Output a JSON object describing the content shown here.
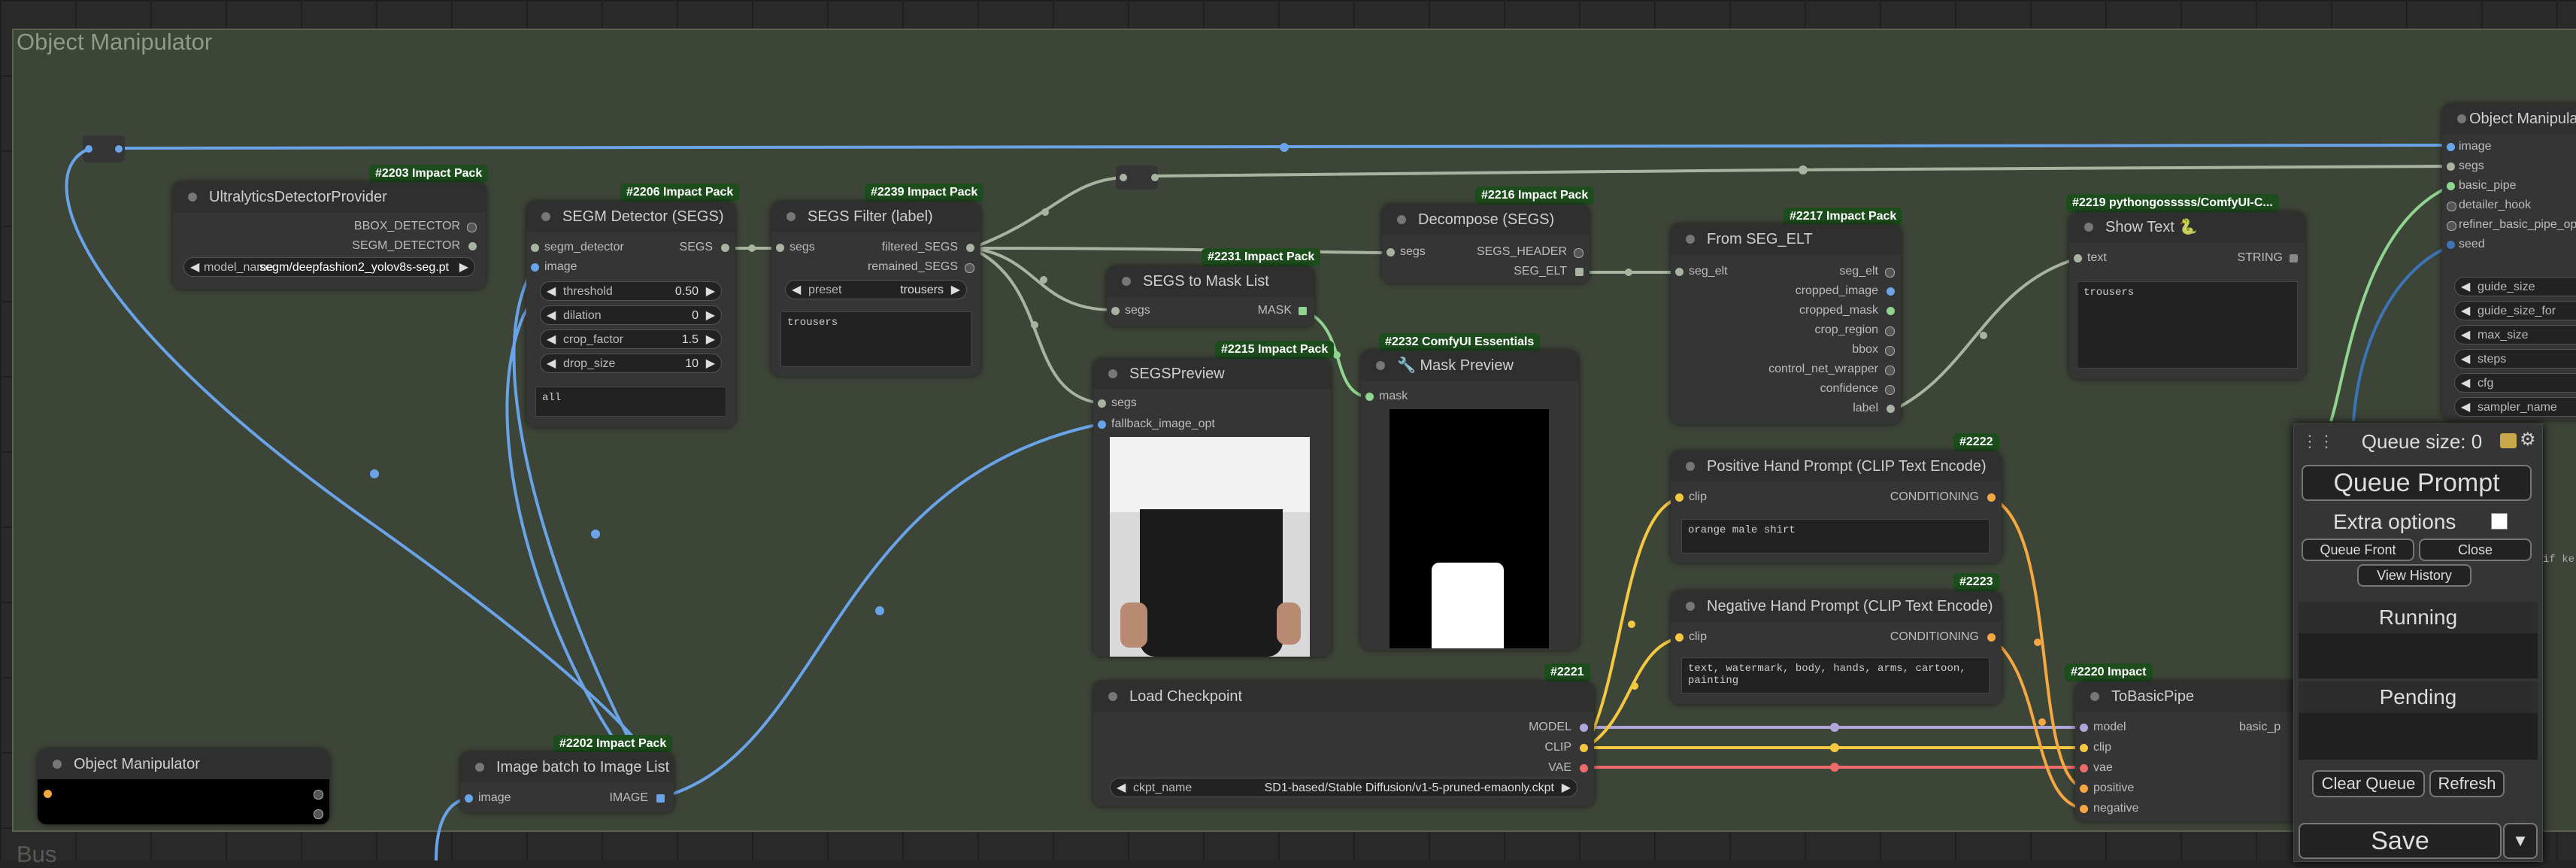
{
  "groups": {
    "main_title": "Object Manipulator",
    "bus_title": "Bus"
  },
  "nodes": {
    "ultralytics": {
      "badge": "#2203 Impact Pack",
      "title": "UltralyticsDetectorProvider",
      "outputs": [
        "BBOX_DETECTOR",
        "SEGM_DETECTOR"
      ],
      "model_label": "model_name",
      "model_value": "segm/deepfashion2_yolov8s-seg.pt"
    },
    "segm_detector": {
      "badge": "#2206 Impact Pack",
      "title": "SEGM Detector (SEGS)",
      "inputs": [
        "segm_detector",
        "image"
      ],
      "output": "SEGS",
      "widgets": [
        {
          "label": "threshold",
          "value": "0.50"
        },
        {
          "label": "dilation",
          "value": "0"
        },
        {
          "label": "crop_factor",
          "value": "1.5"
        },
        {
          "label": "drop_size",
          "value": "10"
        }
      ],
      "text": "all"
    },
    "segs_filter": {
      "badge": "#2239 Impact Pack",
      "title": "SEGS Filter (label)",
      "input": "segs",
      "outputs": [
        "filtered_SEGS",
        "remained_SEGS"
      ],
      "preset_label": "preset",
      "preset_value": "trousers",
      "text": "trousers"
    },
    "segs_to_mask": {
      "badge": "#2231 Impact Pack",
      "title": "SEGS to Mask List",
      "input": "segs",
      "output": "MASK"
    },
    "segs_preview": {
      "badge": "#2215 Impact Pack",
      "title": "SEGSPreview",
      "inputs": [
        "segs",
        "fallback_image_opt"
      ]
    },
    "decompose": {
      "badge": "#2216 Impact Pack",
      "title": "Decompose (SEGS)",
      "input": "segs",
      "outputs": [
        "SEGS_HEADER",
        "SEG_ELT"
      ]
    },
    "mask_preview": {
      "badge": "#2232 ComfyUI Essentials",
      "title": "🔧 Mask Preview",
      "input": "mask"
    },
    "from_seg_elt": {
      "badge": "#2217 Impact Pack",
      "title": "From SEG_ELT",
      "input": "seg_elt",
      "outputs": [
        "seg_elt",
        "cropped_image",
        "cropped_mask",
        "crop_region",
        "bbox",
        "control_net_wrapper",
        "confidence",
        "label"
      ]
    },
    "show_text": {
      "badge": "#2219 pythongosssss/ComfyUI-C...",
      "title": "Show Text 🐍",
      "input": "text",
      "output": "STRING",
      "text": "trousers"
    },
    "obj_manip_right": {
      "title": "Object Manipulat",
      "inputs": [
        "image",
        "segs",
        "basic_pipe",
        "detailer_hook",
        "refiner_basic_pipe_op",
        "seed"
      ],
      "widgets": [
        "guide_size",
        "guide_size_for",
        "max_size",
        "steps",
        "cfg",
        "sampler_name"
      ]
    },
    "pos_prompt": {
      "badge": "#2222",
      "title": "Positive Hand Prompt (CLIP Text Encode)",
      "input": "clip",
      "output": "CONDITIONING",
      "text": "orange male shirt"
    },
    "neg_prompt": {
      "badge": "#2223",
      "title": "Negative Hand Prompt (CLIP Text Encode)",
      "input": "clip",
      "output": "CONDITIONING",
      "text": "text, watermark, body, hands, arms, cartoon,\npainting"
    },
    "load_checkpoint": {
      "badge": "#2221",
      "title": "Load Checkpoint",
      "outputs": [
        "MODEL",
        "CLIP",
        "VAE"
      ],
      "ckpt_label": "ckpt_name",
      "ckpt_value": "SD1-based/Stable Diffusion/v1-5-pruned-emaonly.ckpt"
    },
    "to_basic_pipe": {
      "badge": "#2220 Impact",
      "title": "ToBasicPipe",
      "inputs": [
        "model",
        "clip",
        "vae",
        "positive",
        "negative"
      ],
      "output": "basic_p"
    },
    "image_batch": {
      "badge": "#2202 Impact Pack",
      "title": "Image batch to Image List",
      "input": "image",
      "output": "IMAGE"
    },
    "obj_manip_left": {
      "title": "Object Manipulator"
    }
  },
  "queue_panel": {
    "queue_size": "Queue size: 0",
    "queue_prompt": "Queue Prompt",
    "extra_options": "Extra options",
    "queue_front": "Queue Front",
    "close": "Close",
    "view_history": "View History",
    "running": "Running",
    "pending": "Pending",
    "clear_queue": "Clear Queue",
    "refresh": "Refresh",
    "save": "Save",
    "partial_text": "if ke"
  },
  "colors": {
    "wire_image": "#6aa4e8",
    "wire_segs": "#a8b4a0",
    "wire_clip": "#f5c842",
    "wire_conditioning": "#f5a742",
    "wire_model": "#b0a6dc",
    "wire_vae": "#ee6b6b",
    "badge_bg": "#1d4d1d"
  }
}
